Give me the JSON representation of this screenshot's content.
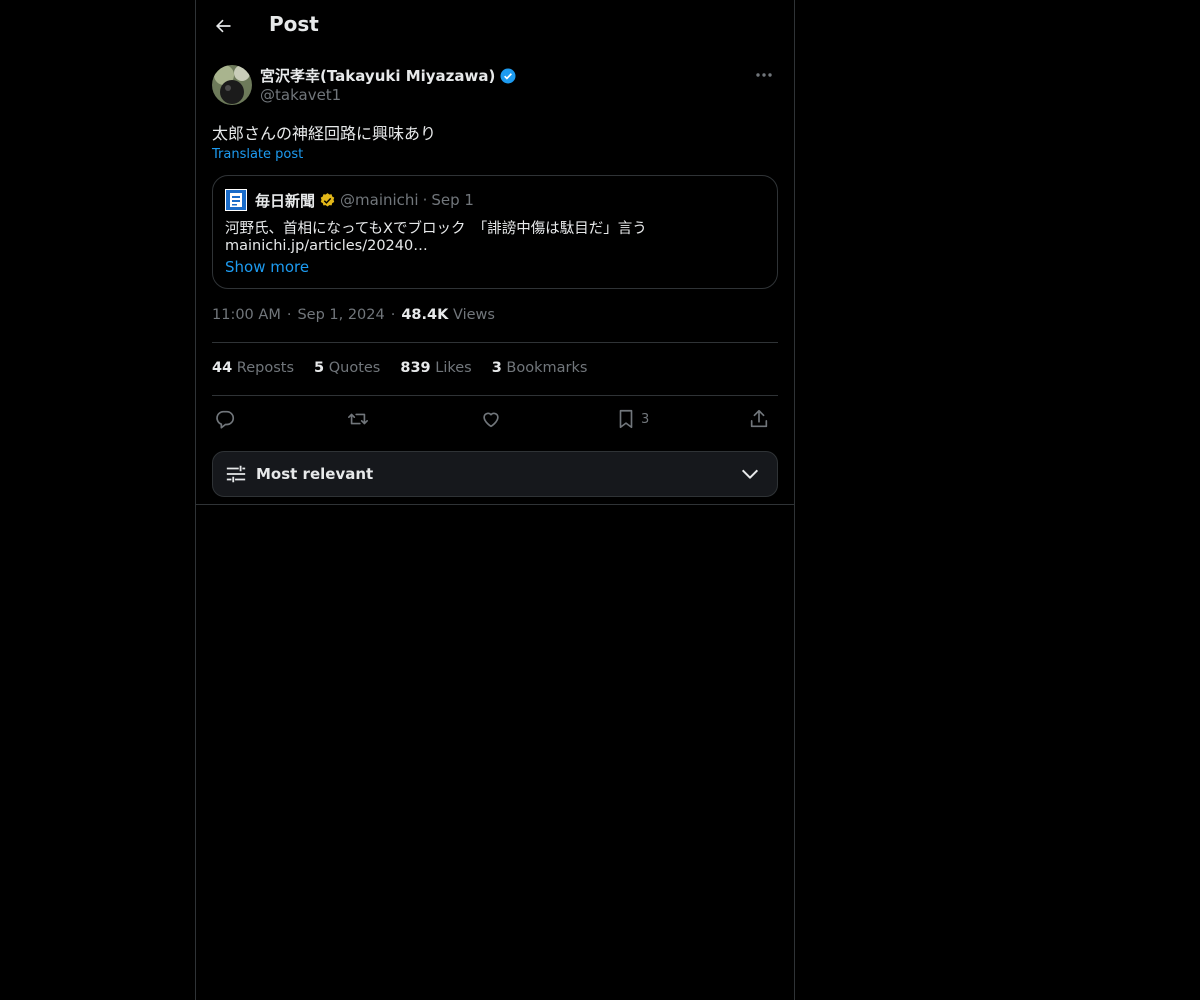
{
  "header": {
    "title": "Post"
  },
  "post": {
    "author": {
      "display_name": "宮沢孝幸(Takayuki Miyazawa)",
      "handle": "@takavet1"
    },
    "text": "太郎さんの神経回路に興味あり",
    "translate_label": "Translate post",
    "quote": {
      "name": "毎日新聞",
      "handle": "@mainichi",
      "date": "Sep 1",
      "separator": "·",
      "text_line1": "河野氏、首相になってもXでブロック　「誹謗中傷は駄目だ」言う",
      "text_line2": "mainichi.jp/articles/20240…",
      "show_more": "Show more"
    },
    "meta": {
      "time": "11:00 AM",
      "date": "Sep 1, 2024",
      "views_count": "48.4K",
      "views_label": "Views",
      "separator": "·"
    },
    "stats": [
      {
        "count": "44",
        "label": "Reposts"
      },
      {
        "count": "5",
        "label": "Quotes"
      },
      {
        "count": "839",
        "label": "Likes"
      },
      {
        "count": "3",
        "label": "Bookmarks"
      }
    ],
    "actions": {
      "bookmark_count": "3"
    }
  },
  "sort": {
    "label": "Most relevant"
  },
  "colors": {
    "accent": "#1d9bf0",
    "background": "#000000",
    "border": "#2f3336",
    "muted": "#71767b",
    "gold_badge": "#e2b719"
  },
  "icons": [
    "back-arrow-icon",
    "verified-badge-icon",
    "more-icon",
    "gold-verified-icon",
    "reply-icon",
    "repost-icon",
    "like-icon",
    "bookmark-icon",
    "share-icon",
    "sliders-icon",
    "chevron-down-icon"
  ]
}
